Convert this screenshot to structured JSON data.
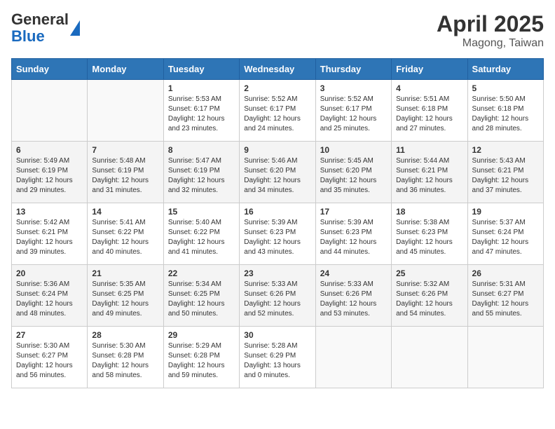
{
  "header": {
    "logo_general": "General",
    "logo_blue": "Blue",
    "month_year": "April 2025",
    "location": "Magong, Taiwan"
  },
  "days_of_week": [
    "Sunday",
    "Monday",
    "Tuesday",
    "Wednesday",
    "Thursday",
    "Friday",
    "Saturday"
  ],
  "weeks": [
    [
      {
        "day": "",
        "info": ""
      },
      {
        "day": "",
        "info": ""
      },
      {
        "day": "1",
        "info": "Sunrise: 5:53 AM\nSunset: 6:17 PM\nDaylight: 12 hours and 23 minutes."
      },
      {
        "day": "2",
        "info": "Sunrise: 5:52 AM\nSunset: 6:17 PM\nDaylight: 12 hours and 24 minutes."
      },
      {
        "day": "3",
        "info": "Sunrise: 5:52 AM\nSunset: 6:17 PM\nDaylight: 12 hours and 25 minutes."
      },
      {
        "day": "4",
        "info": "Sunrise: 5:51 AM\nSunset: 6:18 PM\nDaylight: 12 hours and 27 minutes."
      },
      {
        "day": "5",
        "info": "Sunrise: 5:50 AM\nSunset: 6:18 PM\nDaylight: 12 hours and 28 minutes."
      }
    ],
    [
      {
        "day": "6",
        "info": "Sunrise: 5:49 AM\nSunset: 6:19 PM\nDaylight: 12 hours and 29 minutes."
      },
      {
        "day": "7",
        "info": "Sunrise: 5:48 AM\nSunset: 6:19 PM\nDaylight: 12 hours and 31 minutes."
      },
      {
        "day": "8",
        "info": "Sunrise: 5:47 AM\nSunset: 6:19 PM\nDaylight: 12 hours and 32 minutes."
      },
      {
        "day": "9",
        "info": "Sunrise: 5:46 AM\nSunset: 6:20 PM\nDaylight: 12 hours and 34 minutes."
      },
      {
        "day": "10",
        "info": "Sunrise: 5:45 AM\nSunset: 6:20 PM\nDaylight: 12 hours and 35 minutes."
      },
      {
        "day": "11",
        "info": "Sunrise: 5:44 AM\nSunset: 6:21 PM\nDaylight: 12 hours and 36 minutes."
      },
      {
        "day": "12",
        "info": "Sunrise: 5:43 AM\nSunset: 6:21 PM\nDaylight: 12 hours and 37 minutes."
      }
    ],
    [
      {
        "day": "13",
        "info": "Sunrise: 5:42 AM\nSunset: 6:21 PM\nDaylight: 12 hours and 39 minutes."
      },
      {
        "day": "14",
        "info": "Sunrise: 5:41 AM\nSunset: 6:22 PM\nDaylight: 12 hours and 40 minutes."
      },
      {
        "day": "15",
        "info": "Sunrise: 5:40 AM\nSunset: 6:22 PM\nDaylight: 12 hours and 41 minutes."
      },
      {
        "day": "16",
        "info": "Sunrise: 5:39 AM\nSunset: 6:23 PM\nDaylight: 12 hours and 43 minutes."
      },
      {
        "day": "17",
        "info": "Sunrise: 5:39 AM\nSunset: 6:23 PM\nDaylight: 12 hours and 44 minutes."
      },
      {
        "day": "18",
        "info": "Sunrise: 5:38 AM\nSunset: 6:23 PM\nDaylight: 12 hours and 45 minutes."
      },
      {
        "day": "19",
        "info": "Sunrise: 5:37 AM\nSunset: 6:24 PM\nDaylight: 12 hours and 47 minutes."
      }
    ],
    [
      {
        "day": "20",
        "info": "Sunrise: 5:36 AM\nSunset: 6:24 PM\nDaylight: 12 hours and 48 minutes."
      },
      {
        "day": "21",
        "info": "Sunrise: 5:35 AM\nSunset: 6:25 PM\nDaylight: 12 hours and 49 minutes."
      },
      {
        "day": "22",
        "info": "Sunrise: 5:34 AM\nSunset: 6:25 PM\nDaylight: 12 hours and 50 minutes."
      },
      {
        "day": "23",
        "info": "Sunrise: 5:33 AM\nSunset: 6:26 PM\nDaylight: 12 hours and 52 minutes."
      },
      {
        "day": "24",
        "info": "Sunrise: 5:33 AM\nSunset: 6:26 PM\nDaylight: 12 hours and 53 minutes."
      },
      {
        "day": "25",
        "info": "Sunrise: 5:32 AM\nSunset: 6:26 PM\nDaylight: 12 hours and 54 minutes."
      },
      {
        "day": "26",
        "info": "Sunrise: 5:31 AM\nSunset: 6:27 PM\nDaylight: 12 hours and 55 minutes."
      }
    ],
    [
      {
        "day": "27",
        "info": "Sunrise: 5:30 AM\nSunset: 6:27 PM\nDaylight: 12 hours and 56 minutes."
      },
      {
        "day": "28",
        "info": "Sunrise: 5:30 AM\nSunset: 6:28 PM\nDaylight: 12 hours and 58 minutes."
      },
      {
        "day": "29",
        "info": "Sunrise: 5:29 AM\nSunset: 6:28 PM\nDaylight: 12 hours and 59 minutes."
      },
      {
        "day": "30",
        "info": "Sunrise: 5:28 AM\nSunset: 6:29 PM\nDaylight: 13 hours and 0 minutes."
      },
      {
        "day": "",
        "info": ""
      },
      {
        "day": "",
        "info": ""
      },
      {
        "day": "",
        "info": ""
      }
    ]
  ]
}
